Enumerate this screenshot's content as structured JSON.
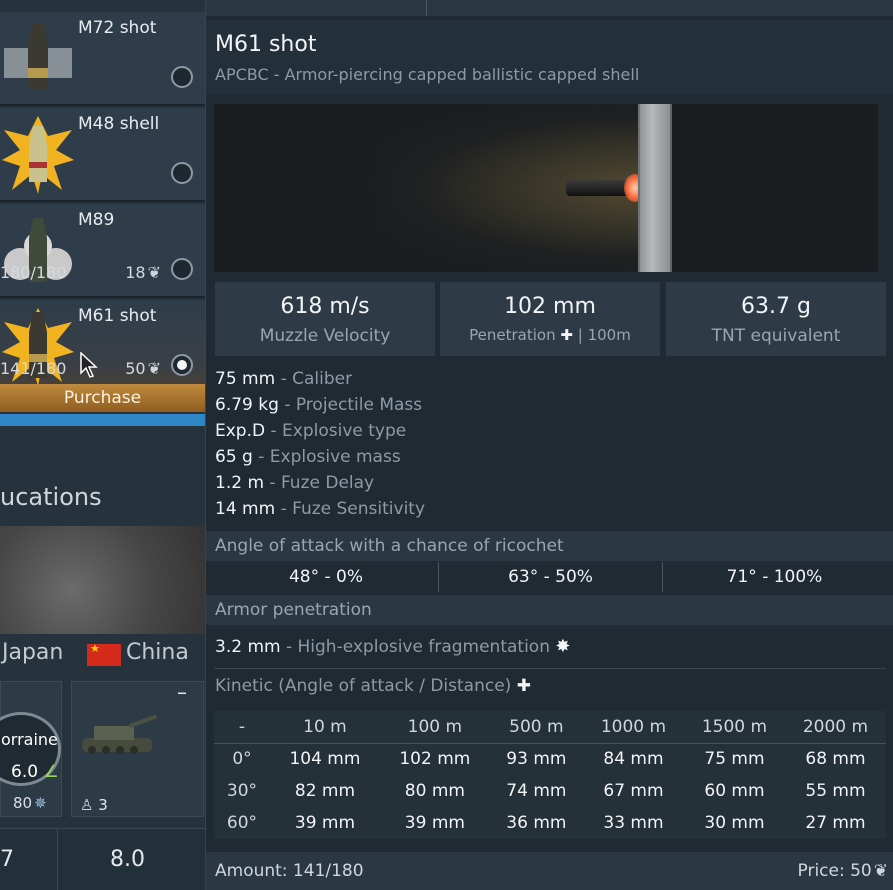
{
  "left": {
    "ammo": [
      {
        "name": "M72 shot",
        "count": "",
        "price": "",
        "selected": false,
        "icon": "ap-shot-icon"
      },
      {
        "name": "M48 shell",
        "count": "",
        "price": "",
        "selected": false,
        "icon": "he-shell-icon"
      },
      {
        "name": "M89",
        "count": "180/180",
        "price": "18",
        "selected": false,
        "icon": "smoke-shell-icon"
      },
      {
        "name": "M61 shot",
        "count": "141/180",
        "price": "50",
        "selected": true,
        "icon": "apcbc-shot-icon"
      }
    ],
    "purchase_label": "Purchase",
    "modifications_title": "ucations",
    "nations": {
      "japan": "Japan",
      "china": "China"
    },
    "card1": {
      "name": "orraine",
      "br": "6.0",
      "cost": "80"
    },
    "card2": {
      "minus": "–",
      "crew": "3"
    },
    "bottom": {
      "br_left": "7",
      "br": "8.0"
    }
  },
  "detail": {
    "title": "M61 shot",
    "subtitle": "APCBC - Armor-piercing capped ballistic capped shell",
    "stats": [
      {
        "value": "618 m/s",
        "label": "Muzzle Velocity"
      },
      {
        "value": "102 mm",
        "label": "Penetration",
        "sub": "| 100m"
      },
      {
        "value": "63.7 g",
        "label": "TNT equivalent"
      }
    ],
    "props": [
      {
        "value": "75 mm",
        "label": "- Caliber"
      },
      {
        "value": "6.79 kg",
        "label": "- Projectile Mass"
      },
      {
        "value": "Exp.D",
        "label": "- Explosive type"
      },
      {
        "value": "65 g",
        "label": "- Explosive mass"
      },
      {
        "value": "1.2 m",
        "label": "- Fuze Delay"
      },
      {
        "value": "14 mm",
        "label": "- Fuze Sensitivity"
      }
    ],
    "ricochet_title": "Angle of attack with a chance of ricochet",
    "ricochet": [
      "48° - 0%",
      "63° - 50%",
      "71° - 100%"
    ],
    "armor_pen_title": "Armor penetration",
    "he_frag": {
      "value": "3.2 mm",
      "label": "- High-explosive fragmentation"
    },
    "kinetic_title": "Kinetic (Angle of attack / Distance)",
    "kinetic": {
      "headers": [
        "-",
        "10 m",
        "100 m",
        "500 m",
        "1000 m",
        "1500 m",
        "2000 m"
      ],
      "rows": [
        {
          "angle": "0°",
          "values": [
            "104 mm",
            "102 mm",
            "93 mm",
            "84 mm",
            "75 mm",
            "68 mm"
          ]
        },
        {
          "angle": "30°",
          "values": [
            "82 mm",
            "80 mm",
            "74 mm",
            "67 mm",
            "60 mm",
            "55 mm"
          ]
        },
        {
          "angle": "60°",
          "values": [
            "39 mm",
            "39 mm",
            "36 mm",
            "33 mm",
            "30 mm",
            "27 mm"
          ]
        }
      ]
    },
    "amount": "Amount: 141/180",
    "price": "Price: 50"
  }
}
